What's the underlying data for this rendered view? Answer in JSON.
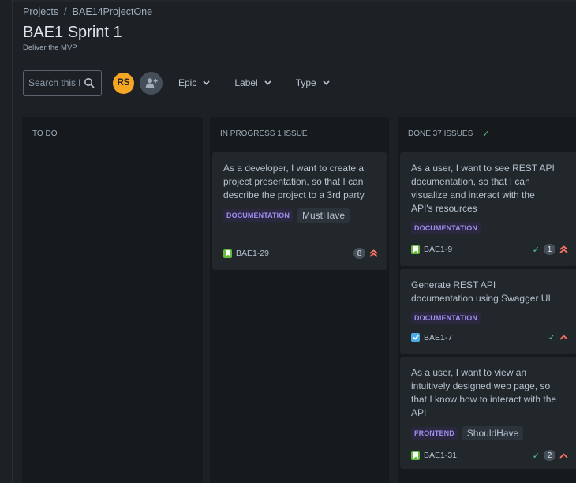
{
  "breadcrumb": {
    "root": "Projects",
    "separator": "/",
    "project": "BAE14ProjectOne"
  },
  "page": {
    "title": "BAE1 Sprint 1",
    "subtitle": "Deliver the MVP"
  },
  "toolbar": {
    "search_placeholder": "Search this board",
    "avatar_initials": "RS",
    "filters": [
      "Epic",
      "Label",
      "Type"
    ]
  },
  "columns": {
    "todo": {
      "title": "TO DO"
    },
    "in_progress": {
      "title": "IN PROGRESS 1 ISSUE"
    },
    "done": {
      "title": "DONE 37 ISSUES"
    }
  },
  "cards": {
    "c1": {
      "summary": "As a developer, I want to create a project presentation, so that I can describe the project to a 3rd party",
      "lozenge": "DOCUMENTATION",
      "tag": "MustHave",
      "key": "BAE1-29",
      "points": "8",
      "type": "story",
      "priority": "highest"
    },
    "c2": {
      "summary": "As a user, I want to see REST API documentation, so that I can visualize and interact with the API's resources",
      "lozenge": "DOCUMENTATION",
      "key": "BAE1-9",
      "points": "1",
      "type": "story",
      "priority": "highest"
    },
    "c3": {
      "summary": "Generate REST API documentation using Swagger UI",
      "lozenge": "DOCUMENTATION",
      "key": "BAE1-7",
      "type": "task",
      "priority": "high"
    },
    "c4": {
      "summary": "As a user, I want to view an intuitively designed web page, so that I know how to interact with the API",
      "lozenge": "FRONTEND",
      "tag": "ShouldHave",
      "key": "BAE1-31",
      "points": "2",
      "type": "story",
      "priority": "high"
    }
  },
  "colors": {
    "avatar": "#f5a623",
    "story": "#63ba3c",
    "task": "#4bade8",
    "priority": "#f87462",
    "done_check": "#4bce97",
    "lozenge_text": "#9f8fef"
  }
}
